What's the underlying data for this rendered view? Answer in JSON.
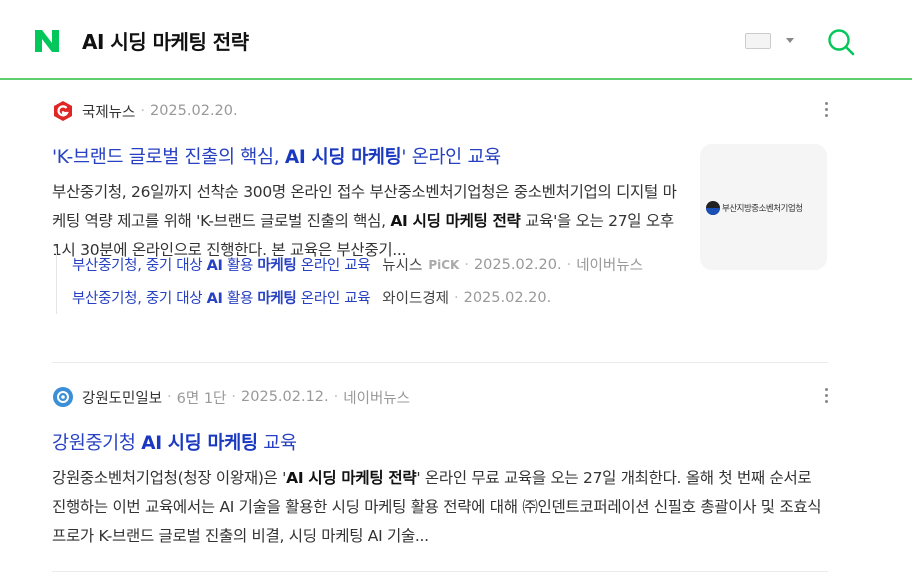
{
  "search": {
    "query": "AI 시딩 마케팅 전략"
  },
  "colors": {
    "brand": "#03c75a",
    "link": "#2741c2",
    "underline": "#5fce6e"
  },
  "icons": {
    "logo": "naver-n-icon",
    "keyboard": "keyboard-icon",
    "search": "search-icon"
  },
  "items": [
    {
      "press": "국제뉴스",
      "date": "2025.02.20.",
      "title_pre": "'K-브랜드 글로벌 진출의 핵심, ",
      "title_bold": "AI 시딩 마케팅",
      "title_post": "' 온라인 교육",
      "desc_pre": "부산중기청, 26일까지 선착순 300명 온라인 접수 부산중소벤처기업청은 중소벤처기업의 디지털 마케팅 역량 제고를 위해 'K-브랜드 글로벌 진출의 핵심, ",
      "desc_bold": "AI 시딩 마케팅 전략",
      "desc_post": " 교육'을 오는 27일 오후 1시 30분에 온라인으로 진행한다. 본 교육은 부산중기...",
      "thumb_text": "부산지방중소벤처기업청",
      "related": [
        {
          "t1": "부산중기청, 중기 대상 ",
          "b1": "AI",
          "t2": " 활용 ",
          "b2": "마케팅",
          "t3": " 온라인 교육",
          "press": "뉴시스",
          "pick": "PiCK",
          "date": "2025.02.20.",
          "source": "네이버뉴스"
        },
        {
          "t1": "부산중기청, 중기 대상 ",
          "b1": "AI",
          "t2": " 활용 ",
          "b2": "마케팅",
          "t3": " 온라인 교육",
          "press": "와이드경제",
          "date": "2025.02.20."
        }
      ]
    },
    {
      "press": "강원도민일보",
      "page": "6면 1단",
      "date": "2025.02.12.",
      "source": "네이버뉴스",
      "title_pre": "강원중기청 ",
      "title_bold": "AI 시딩 마케팅",
      "title_post": " 교육",
      "desc_pre": "강원중소벤처기업청(청장 이왕재)은 '",
      "desc_bold": "AI 시딩 마케팅 전략",
      "desc_post": "' 온라인 무료 교육을 오는 27일 개최한다. 올해 첫 번째 순서로 진행하는 이번 교육에서는 AI 기술을 활용한 시딩 마케팅 활용 전략에 대해 ㈜인덴트코퍼레이션 신필호 총괄이사 및 조효식 프로가 K-브랜드 글로벌 진출의 비결, 시딩 마케팅 AI 기술..."
    }
  ]
}
